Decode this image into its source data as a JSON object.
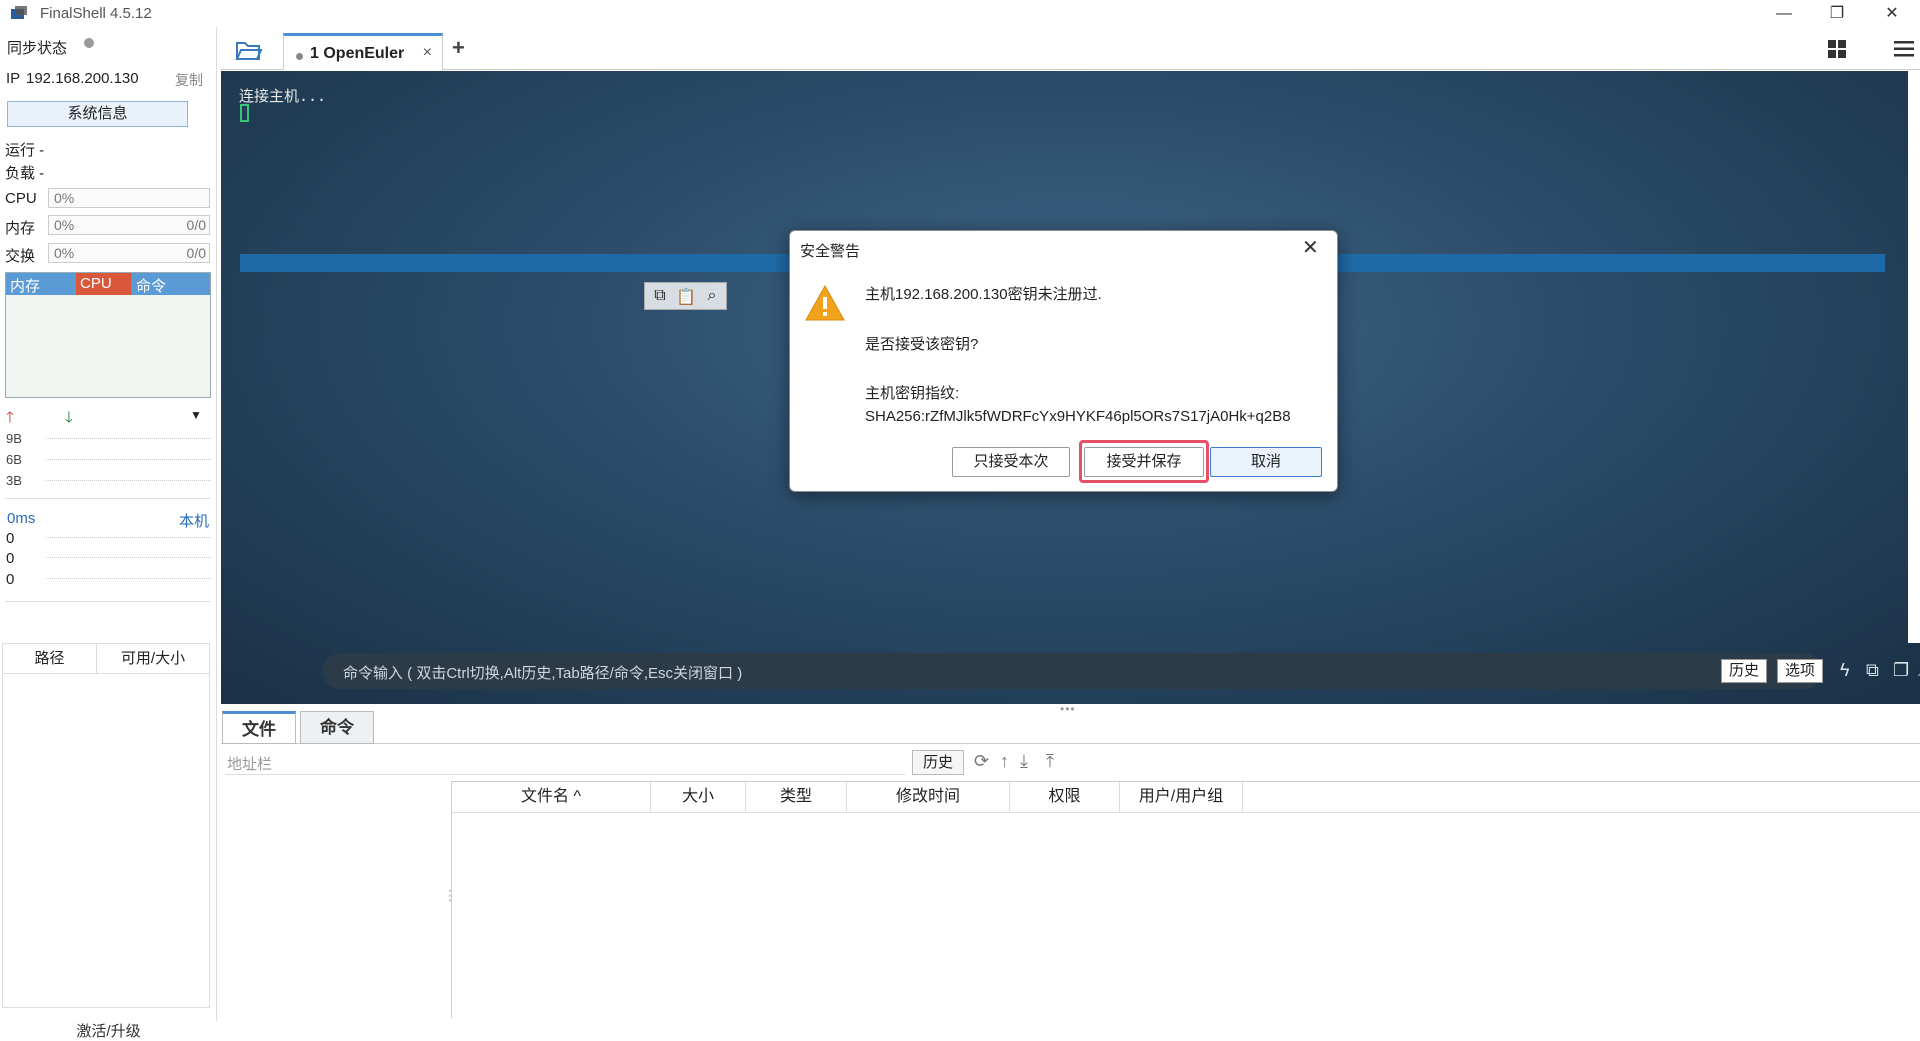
{
  "window": {
    "title": "FinalShell 4.5.12",
    "icons": [
      "minimize-icon",
      "restore-icon",
      "close-icon"
    ]
  },
  "sidebar": {
    "sync_label": "同步状态",
    "ip_label": "IP",
    "ip_value": "192.168.200.130",
    "copy_label": "复制",
    "sysinfo_button": "系统信息",
    "run_label": "运行 -",
    "load_label": "负载 -",
    "resources": [
      {
        "label": "CPU",
        "percent": "0%",
        "fraction": ""
      },
      {
        "label": "内存",
        "percent": "0%",
        "fraction": "0/0"
      },
      {
        "label": "交换",
        "percent": "0%",
        "fraction": "0/0"
      }
    ],
    "process_tabs": [
      "内存",
      "CPU",
      "命令"
    ],
    "net_scale": [
      "9B",
      "6B",
      "3B"
    ],
    "latency_label": "0ms",
    "latency_host": "本机",
    "latency_values": [
      "0",
      "0",
      "0"
    ],
    "path_header": "路径",
    "size_header": "可用/大小",
    "activate_label": "激活/升级"
  },
  "tabs": {
    "session_label": "1 OpenEuler",
    "close": "×",
    "add": "+"
  },
  "terminal": {
    "output": "连接主机...",
    "command_placeholder": "命令输入 ( 双击Ctrl切换,Alt历史,Tab路径/命令,Esc关闭窗口 )",
    "history_button": "历史",
    "options_button": "选项"
  },
  "dialog": {
    "title": "安全警告",
    "close": "✕",
    "message": "主机192.168.200.130密钥未注册过.",
    "question": "是否接受该密钥?",
    "fingerprint_label": "主机密钥指纹:",
    "fingerprint": "SHA256:rZfMJlk5fWDRFcYx9HYKF46pl5ORs7S17jA0Hk+q2B8",
    "accept_once": "只接受本次",
    "accept_save": "接受并保存",
    "cancel": "取消"
  },
  "file_panel": {
    "tabs": [
      "文件",
      "命令"
    ],
    "address_label": "地址栏",
    "history_button": "历史",
    "columns": [
      "文件名 ^",
      "大小",
      "类型",
      "修改时间",
      "权限",
      "用户/用户组"
    ]
  },
  "colors": {
    "accent": "#4a8fd4",
    "cpu_tab": "#d9583b",
    "highlight": "#e8506a"
  }
}
